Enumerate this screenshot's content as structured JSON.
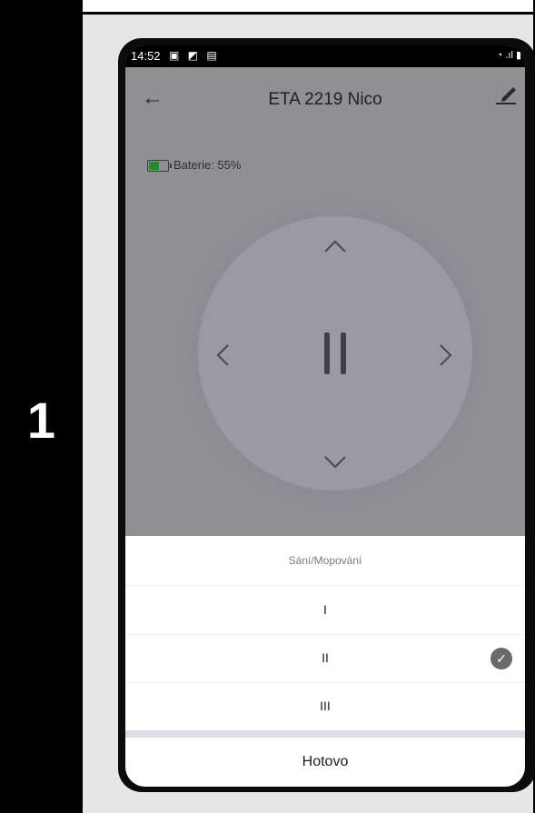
{
  "step_label": "1",
  "status_bar": {
    "time": "14:52",
    "notification_icons": "▣ ◩ ▤",
    "signal_icons": "◔ .ıl ▮"
  },
  "header": {
    "back_icon": "arrow-left-icon",
    "title": "ETA 2219 Nico",
    "edit_icon": "pencil-icon"
  },
  "battery": {
    "label": "Baterie: 55%",
    "level": 0.55,
    "color": "#1e8d2c"
  },
  "dpad": {
    "up": "^",
    "down": "v",
    "left": "<",
    "right": ">",
    "center": "pause"
  },
  "sheet": {
    "title": "Sání/Mopování",
    "options": [
      {
        "label": "I",
        "selected": false
      },
      {
        "label": "II",
        "selected": true
      },
      {
        "label": "III",
        "selected": false
      }
    ],
    "done_label": "Hotovo",
    "check_glyph": "✓"
  }
}
